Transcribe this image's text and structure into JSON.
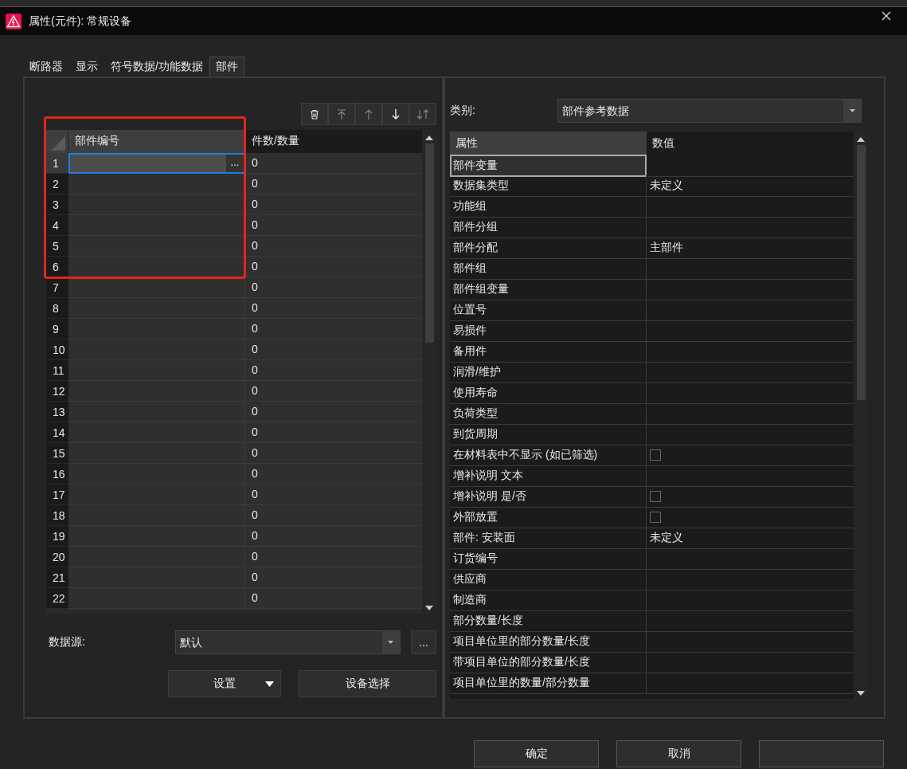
{
  "window": {
    "title": "属性(元件): 常规设备"
  },
  "tabs": [
    {
      "label": "断路器",
      "selected": false
    },
    {
      "label": "显示",
      "selected": false
    },
    {
      "label": "符号数据/功能数据",
      "selected": false
    },
    {
      "label": "部件",
      "selected": true
    }
  ],
  "parts_grid": {
    "columns": [
      "部件编号",
      "件数/数量"
    ],
    "edit_button": "...",
    "rows": [
      {
        "number": "1",
        "quantity": "0",
        "selected": true
      },
      {
        "number": "2",
        "quantity": "0",
        "selected": false
      },
      {
        "number": "3",
        "quantity": "0",
        "selected": false
      },
      {
        "number": "4",
        "quantity": "0",
        "selected": false
      },
      {
        "number": "5",
        "quantity": "0",
        "selected": false
      },
      {
        "number": "6",
        "quantity": "0",
        "selected": false
      },
      {
        "number": "7",
        "quantity": "0",
        "selected": false
      },
      {
        "number": "8",
        "quantity": "0",
        "selected": false
      },
      {
        "number": "9",
        "quantity": "0",
        "selected": false
      },
      {
        "number": "10",
        "quantity": "0",
        "selected": false
      },
      {
        "number": "11",
        "quantity": "0",
        "selected": false
      },
      {
        "number": "12",
        "quantity": "0",
        "selected": false
      },
      {
        "number": "13",
        "quantity": "0",
        "selected": false
      },
      {
        "number": "14",
        "quantity": "0",
        "selected": false
      },
      {
        "number": "15",
        "quantity": "0",
        "selected": false
      },
      {
        "number": "16",
        "quantity": "0",
        "selected": false
      },
      {
        "number": "17",
        "quantity": "0",
        "selected": false
      },
      {
        "number": "18",
        "quantity": "0",
        "selected": false
      },
      {
        "number": "19",
        "quantity": "0",
        "selected": false
      },
      {
        "number": "20",
        "quantity": "0",
        "selected": false
      },
      {
        "number": "21",
        "quantity": "0",
        "selected": false
      },
      {
        "number": "22",
        "quantity": "0",
        "selected": false
      }
    ]
  },
  "data_source": {
    "label": "数据源:",
    "value": "默认",
    "browse": "..."
  },
  "left_buttons": [
    {
      "label": "设置",
      "has_menu": true
    },
    {
      "label": "设备选择",
      "has_menu": false
    }
  ],
  "category": {
    "label": "类别:",
    "value": "部件参考数据"
  },
  "property_grid": {
    "columns": [
      "属性",
      "数值"
    ],
    "rows": [
      {
        "name": "部件变量",
        "kind": "text",
        "selected": true
      },
      {
        "name": "数据集类型",
        "kind": "text",
        "value": "未定义",
        "selected": false
      },
      {
        "name": "功能组",
        "kind": "text",
        "selected": false
      },
      {
        "name": "部件分组",
        "kind": "text",
        "selected": false
      },
      {
        "name": "部件分配",
        "kind": "text",
        "value": "主部件",
        "selected": false
      },
      {
        "name": "部件组",
        "kind": "text",
        "selected": false
      },
      {
        "name": "部件组变量",
        "kind": "text",
        "selected": false
      },
      {
        "name": "位置号",
        "kind": "text",
        "selected": false
      },
      {
        "name": "易损件",
        "kind": "text",
        "selected": false
      },
      {
        "name": "备用件",
        "kind": "text",
        "selected": false
      },
      {
        "name": "润滑/维护",
        "kind": "text",
        "selected": false
      },
      {
        "name": "使用寿命",
        "kind": "text",
        "selected": false
      },
      {
        "name": "负荷类型",
        "kind": "text",
        "selected": false
      },
      {
        "name": "到货周期",
        "kind": "text",
        "selected": false
      },
      {
        "name": "在材料表中不显示 (如已筛选)",
        "kind": "checkbox",
        "checked": false,
        "selected": false
      },
      {
        "name": "增补说明 文本",
        "kind": "text",
        "selected": false
      },
      {
        "name": "增补说明 是/否",
        "kind": "checkbox",
        "checked": false,
        "selected": false
      },
      {
        "name": "外部放置",
        "kind": "checkbox",
        "checked": false,
        "selected": false
      },
      {
        "name": "部件: 安装面",
        "kind": "text",
        "value": "未定义",
        "selected": false
      },
      {
        "name": "订货编号",
        "kind": "text",
        "selected": false
      },
      {
        "name": "供应商",
        "kind": "text",
        "selected": false
      },
      {
        "name": "制造商",
        "kind": "text",
        "selected": false
      },
      {
        "name": "部分数量/长度",
        "kind": "text",
        "selected": false
      },
      {
        "name": "项目单位里的部分数量/长度",
        "kind": "text",
        "selected": false
      },
      {
        "name": "带项目单位的部分数量/长度",
        "kind": "text",
        "selected": false
      },
      {
        "name": "项目单位里的数量/部分数量",
        "kind": "text",
        "selected": false
      }
    ]
  },
  "dialog_buttons": [
    {
      "label": "确定"
    },
    {
      "label": "取消"
    },
    {
      "kind": "blank"
    }
  ]
}
